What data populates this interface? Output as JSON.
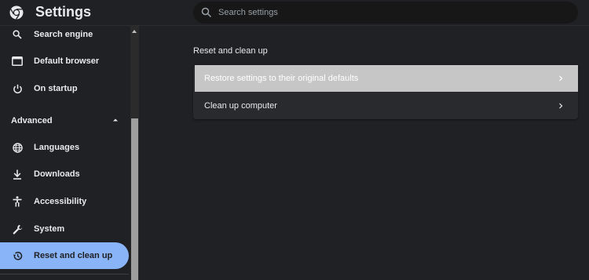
{
  "app": {
    "title": "Settings"
  },
  "search": {
    "placeholder": "Search settings"
  },
  "sidebar": {
    "items_top": [
      {
        "label": "Search engine",
        "icon": "search-icon"
      },
      {
        "label": "Default browser",
        "icon": "browser-window-icon"
      },
      {
        "label": "On startup",
        "icon": "power-icon"
      }
    ],
    "advanced_label": "Advanced",
    "items_advanced": [
      {
        "label": "Languages",
        "icon": "globe-icon"
      },
      {
        "label": "Downloads",
        "icon": "download-icon"
      },
      {
        "label": "Accessibility",
        "icon": "accessibility-icon"
      },
      {
        "label": "System",
        "icon": "wrench-icon"
      },
      {
        "label": "Reset and clean up",
        "icon": "history-icon",
        "active": true
      }
    ]
  },
  "main": {
    "section_title": "Reset and clean up",
    "rows": [
      {
        "label": "Restore settings to their original defaults",
        "highlighted": true
      },
      {
        "label": "Clean up computer"
      }
    ]
  },
  "colors": {
    "background": "#202124",
    "card": "#292a2d",
    "active_item": "#8ab4f8",
    "highlight_row": "#c6c6c6",
    "search_field": "#171717"
  }
}
